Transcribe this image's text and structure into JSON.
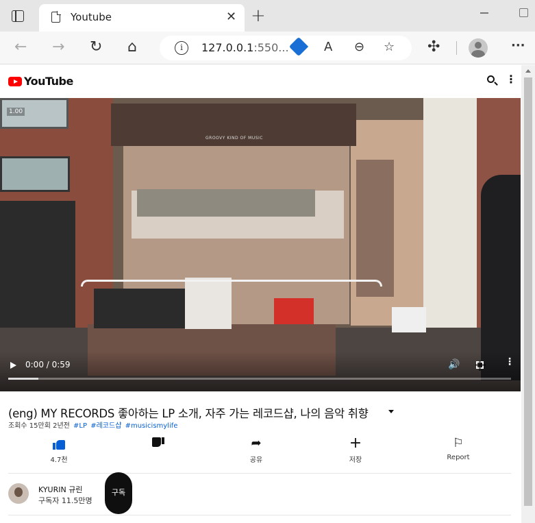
{
  "browser": {
    "tab_title": "Youtube",
    "tab_close": "✕",
    "new_tab": "+",
    "url_host": "127.0.0.1",
    "url_rest": ":550...",
    "info_glyph": "i",
    "back_glyph": "←",
    "forward_glyph": "→",
    "reload_glyph": "↻",
    "home_glyph": "⌂",
    "read_aloud_glyph": "A",
    "zoom_glyph": "⊖",
    "favorite_glyph": "☆",
    "extensions_glyph": "✣",
    "menu_glyph": "···",
    "accent": "#1a6fd6"
  },
  "header": {
    "brand": "YouTube",
    "more_glyph": "⋮"
  },
  "video": {
    "time": "0:00 / 0:59",
    "quality_badge": "1.00",
    "sign_text": "GROOVY KIND OF MUSIC",
    "progress_fraction": 0.06,
    "volume_glyph": "🔊",
    "more_glyph": "⋮"
  },
  "info": {
    "title": "(eng) MY RECORDS 좋아하는 LP 소개, 자주 가는 레코드샵, 나의 음악 취향",
    "meta": "조회수 15만회 2년전",
    "tags": [
      "#LP",
      "#레코드샵",
      "#musicismylife"
    ]
  },
  "actions": [
    {
      "label": "4.7천",
      "icon": "thumb-up-icon"
    },
    {
      "label": "",
      "icon": "thumb-down-icon"
    },
    {
      "label": "공유",
      "icon": "share-icon",
      "glyph": "➦"
    },
    {
      "label": "저장",
      "icon": "save-icon",
      "glyph": "+"
    },
    {
      "label": "Report",
      "icon": "flag-icon",
      "glyph": "⚐"
    }
  ],
  "channel": {
    "name": "KYURIN 규린",
    "subs": "구독자 11.5만명",
    "subscribe_label": "구독"
  }
}
